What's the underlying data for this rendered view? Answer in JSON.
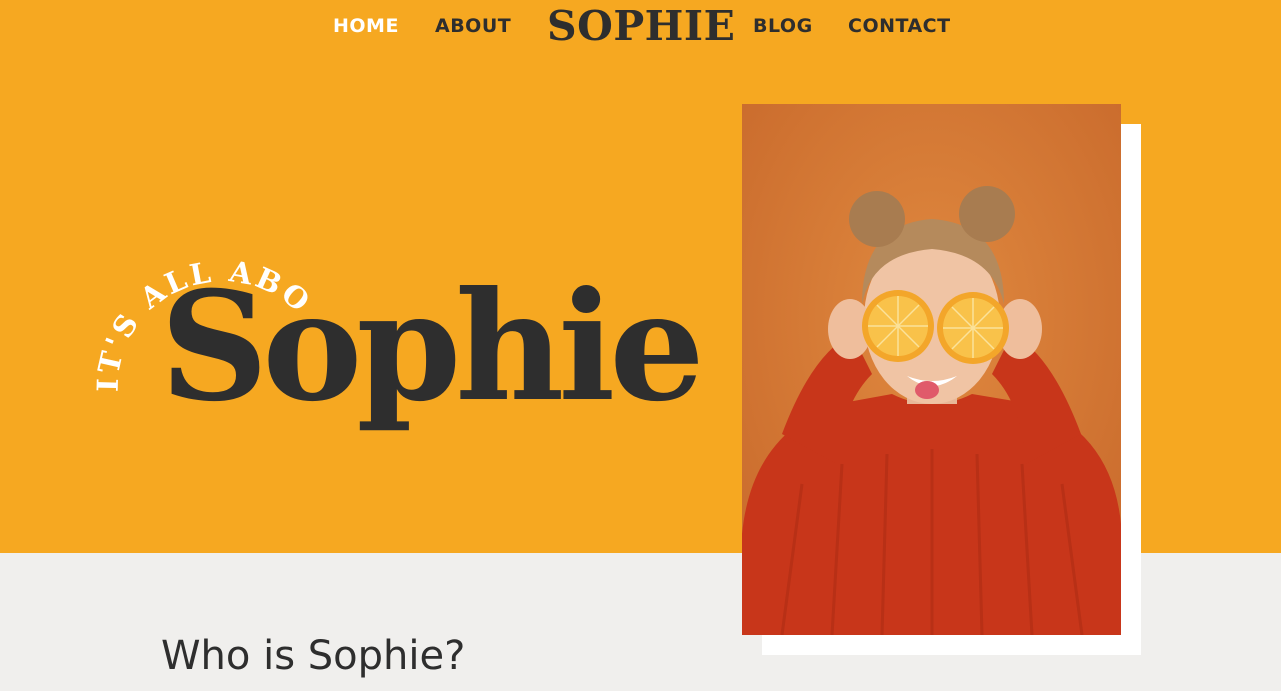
{
  "nav": {
    "home": "HOME",
    "about": "ABOUT",
    "logo": "SOPHIE",
    "blog": "BLOG",
    "contact": "CONTACT"
  },
  "hero": {
    "tagline": "IT'S ALL ABOUT",
    "name": "Sophie",
    "image_alt": "Woman in red sweater holding orange halves over her eyes"
  },
  "about": {
    "title": "Who is Sophie?"
  },
  "colors": {
    "accent": "#f6a821",
    "text_dark": "#2e2e2e",
    "section_bg": "#f0efed",
    "photo_bg": "#d47835"
  }
}
